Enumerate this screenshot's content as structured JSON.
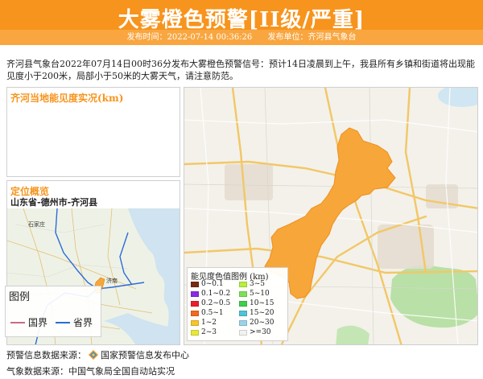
{
  "header": {
    "title": "大雾橙色预警[II级/严重]",
    "publish_time_label": "发布时间：2022-07-14 00:36:26",
    "publish_unit_label": "发布单位：齐河县气象台"
  },
  "description": "齐河县气象台2022年07月14日00时36分发布大雾橙色预警信号：预计14日凌晨到上午，我县所有乡镇和街道将出现能见度小于200米，局部小于50米的大雾天气，请注意防范。",
  "visibility_panel": {
    "title": "齐河当地能见度实况(km)"
  },
  "location_panel": {
    "title": "定位概览",
    "path": "山东省-德州市-齐河县",
    "map_labels": [
      "石家庄",
      "济南"
    ],
    "legend": {
      "title": "图例",
      "items": [
        {
          "label": "国界",
          "color": "#c96b8a"
        },
        {
          "label": "省界",
          "color": "#2b6cd8"
        }
      ]
    }
  },
  "visibility_legend": {
    "title": "能见度色值图例 (km)",
    "items": [
      {
        "label": "0~0.1",
        "color": "#7a2a10"
      },
      {
        "label": "3~5",
        "color": "#b6ef3c"
      },
      {
        "label": "0.1~0.2",
        "color": "#8a2be2"
      },
      {
        "label": "5~10",
        "color": "#7ee05a"
      },
      {
        "label": "0.2~0.5",
        "color": "#e8202a"
      },
      {
        "label": "10~15",
        "color": "#3fce4e"
      },
      {
        "label": "0.5~1",
        "color": "#f26b1d"
      },
      {
        "label": "15~20",
        "color": "#4fc3d6"
      },
      {
        "label": "1~2",
        "color": "#f7c52b"
      },
      {
        "label": "20~30",
        "color": "#9ad4e8"
      },
      {
        "label": "2~3",
        "color": "#e8e83a"
      },
      {
        "label": ">=30",
        "color": "#f2f2f2"
      }
    ]
  },
  "footer": {
    "warning_source_label": "预警信息数据来源：",
    "warning_source": "国家预警信息发布中心",
    "weather_source_label": "气象数据来源：",
    "weather_source": "中国气象局全国自动站实况"
  },
  "colors": {
    "accent": "#f7941d",
    "warning_area": "#f7a63a"
  }
}
